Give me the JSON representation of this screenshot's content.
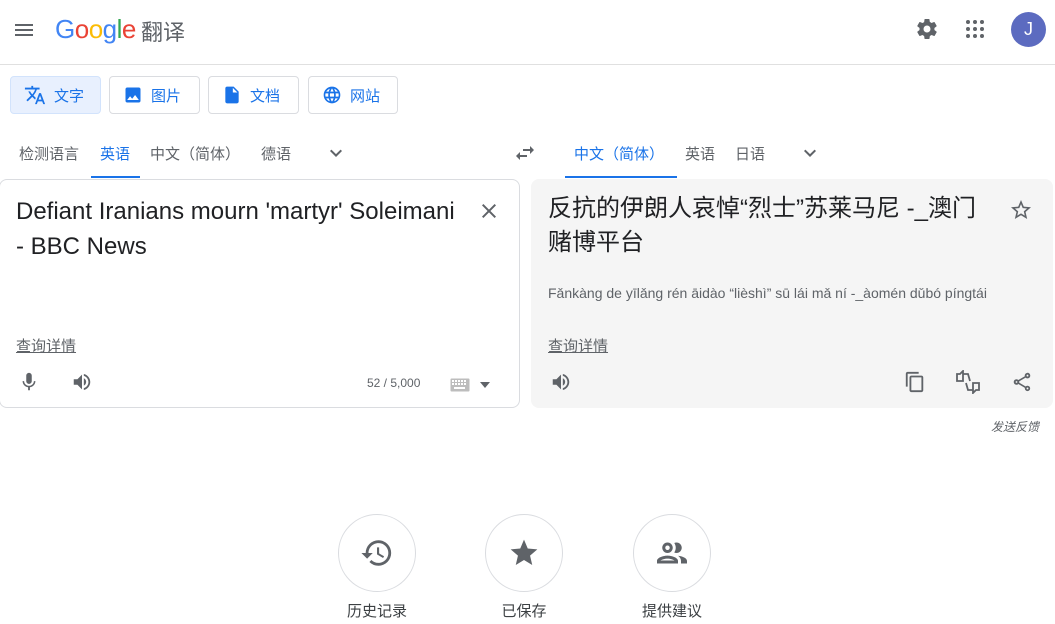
{
  "header": {
    "logo_text": "Google",
    "logo_suffix": "翻译",
    "avatar_letter": "J",
    "icons": [
      "menu-icon",
      "settings-icon",
      "apps-icon"
    ]
  },
  "modes": [
    {
      "label": "文字",
      "icon": "translate-icon",
      "active": true
    },
    {
      "label": "图片",
      "icon": "image-icon"
    },
    {
      "label": "文档",
      "icon": "document-icon"
    },
    {
      "label": "网站",
      "icon": "globe-icon"
    }
  ],
  "source_langs": [
    "检测语言",
    "英语",
    "中文（简体）",
    "德语"
  ],
  "target_langs": [
    "中文（简体）",
    "英语",
    "日语"
  ],
  "source": {
    "text": "Defiant Iranians mourn 'martyr' Soleimani - BBC News",
    "details_link": "查询详情",
    "char_count": "52 / 5,000"
  },
  "target": {
    "text": "反抗的伊朗人哀悼“烈士”苏莱马尼 -_澳门赌博平台",
    "transliteration": "Fǎnkàng de yīlǎng rén āidào “lièshì” sū lái mǎ ní -_àomén dǔbó píngtái",
    "details_link": "查询详情"
  },
  "feedback": "发送反馈",
  "bottom": [
    {
      "label": "历史记录",
      "icon": "history-icon"
    },
    {
      "label": "已保存",
      "icon": "star-icon"
    },
    {
      "label": "提供建议",
      "icon": "community-icon"
    }
  ],
  "colors": {
    "accent": "#1a73e8",
    "icon_gray": "#5f6368",
    "avatar_bg": "#5c6bc0",
    "active_mode_bg": "#e8f0fe",
    "target_bg": "#f5f5f5"
  }
}
